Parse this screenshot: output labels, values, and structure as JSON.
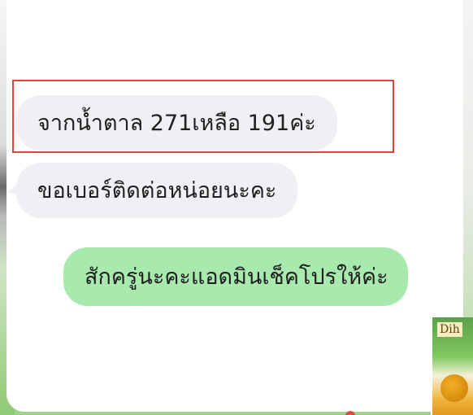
{
  "messages": [
    {
      "direction": "incoming",
      "text": "จากน้ำตาล 271เหลือ 191ค่ะ"
    },
    {
      "direction": "incoming",
      "text": "ขอเบอร์ติดต่อหน่อยนะคะ"
    },
    {
      "direction": "outgoing",
      "text": "สักครู่นะคะแอดมินเช็คโปรให้ค่ะ"
    }
  ],
  "product": {
    "label": "Dih"
  },
  "colors": {
    "incoming_bubble": "#eef0f3",
    "outgoing_bubble": "#a8e9ae",
    "highlight": "#d9473b"
  }
}
